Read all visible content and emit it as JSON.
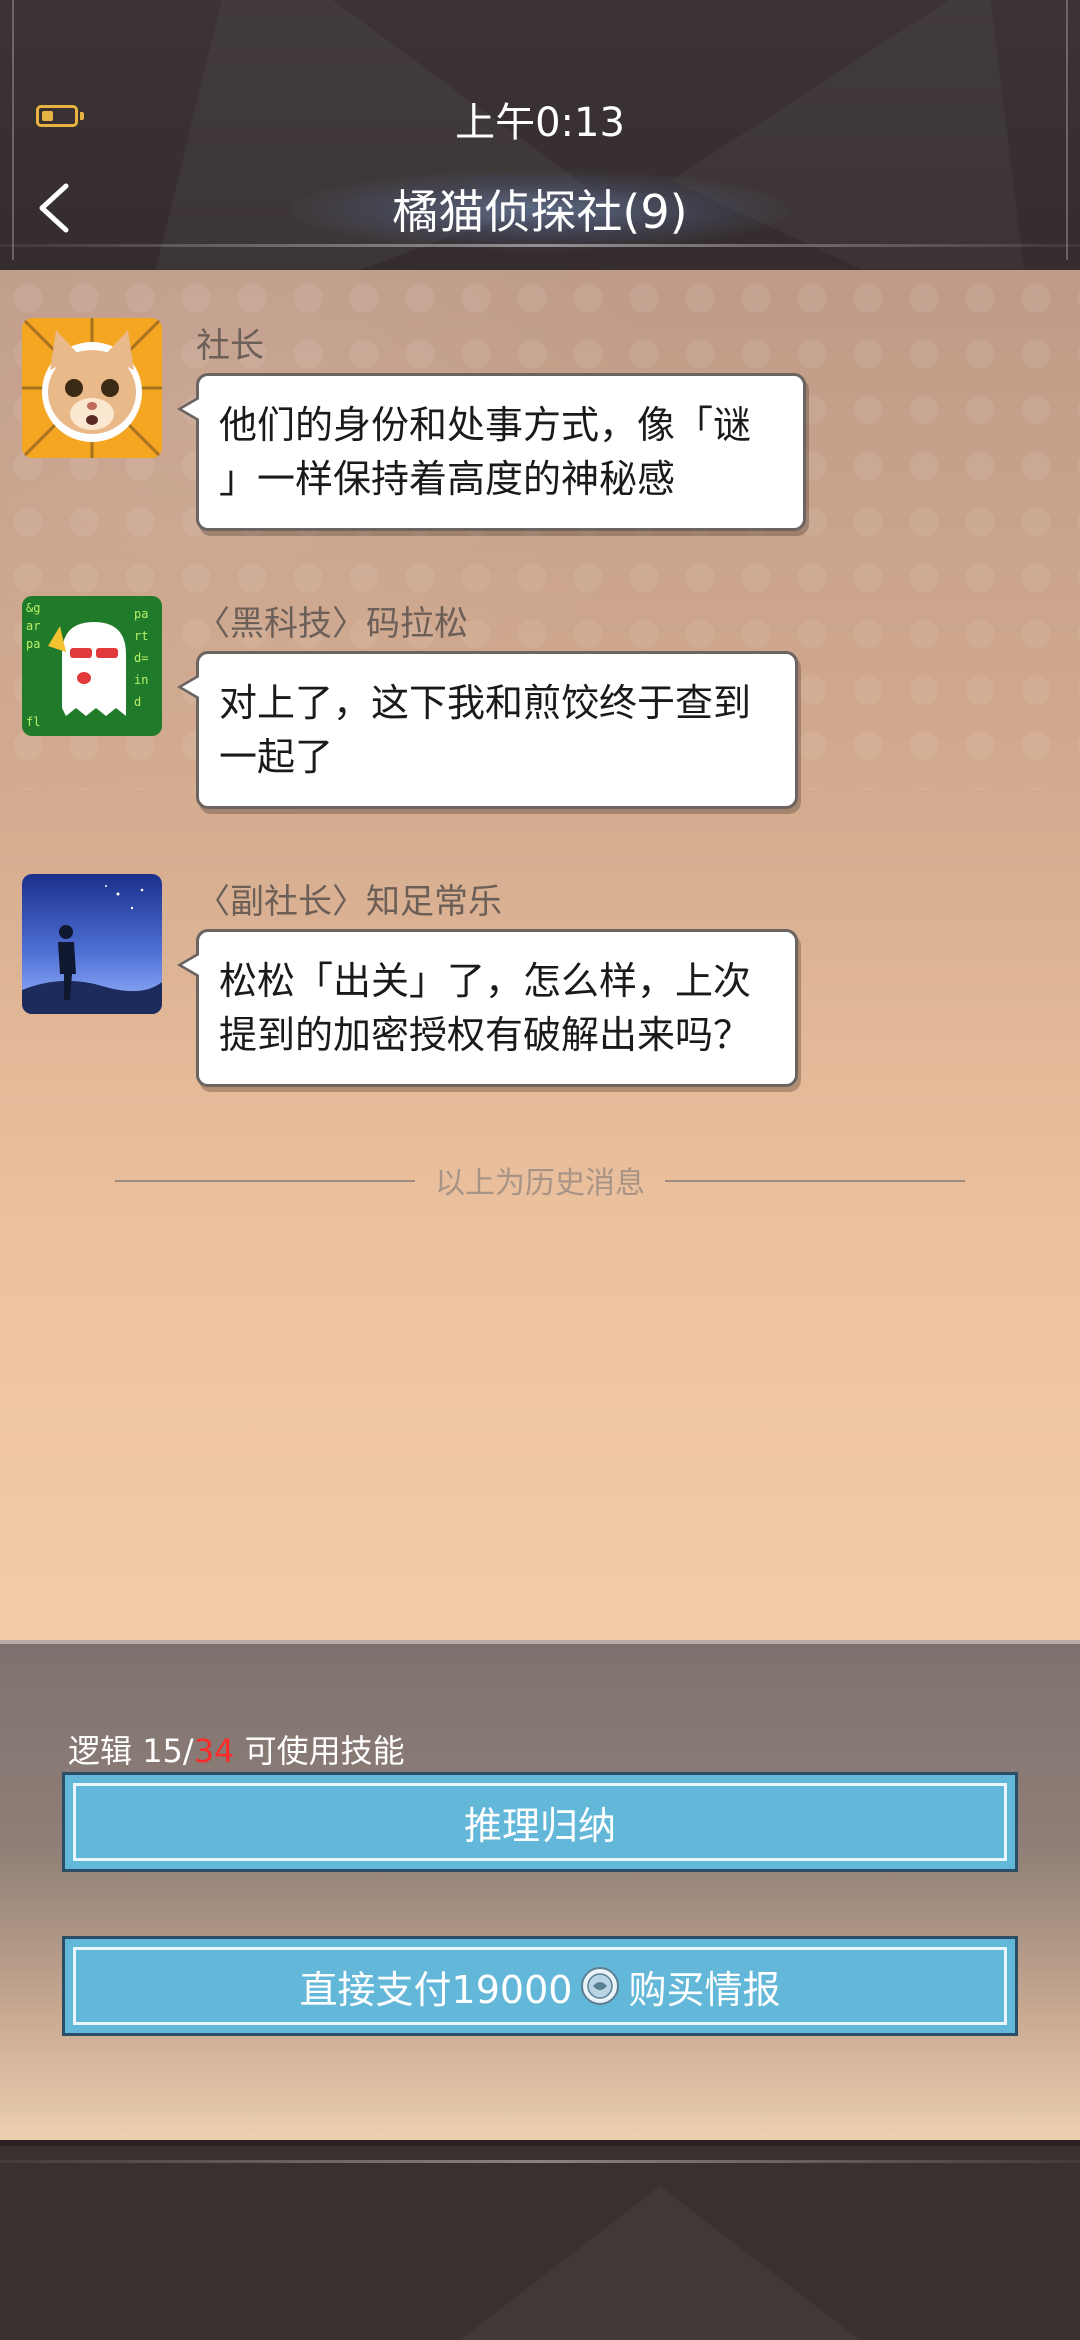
{
  "status_bar": {
    "time": "上午0:13",
    "battery_level": 0.35,
    "battery_color": "#e7b341"
  },
  "header": {
    "back_icon": "chevron-left-icon",
    "title": "橘猫侦探社(9)"
  },
  "messages": [
    {
      "sender": "社长",
      "avatar": "orange-cat-avatar",
      "lines": [
        "他们的身份和处事方式，像「谜",
        "」一样保持着高度的神秘感"
      ]
    },
    {
      "sender": "〈黑科技〉码拉松",
      "avatar": "code-ghost-avatar",
      "lines": [
        "对上了，这下我和煎饺终于查到",
        "一起了"
      ]
    },
    {
      "sender": "〈副社长〉知足常乐",
      "avatar": "night-sky-walker-avatar",
      "lines": [
        "松松「出关」了，怎么样，上次",
        "提到的加密授权有破解出来吗？"
      ]
    }
  ],
  "history_divider": "以上为历史消息",
  "skill_panel": {
    "logic_label": "逻辑",
    "logic_current": "15",
    "logic_separator": "/",
    "logic_max": "34",
    "logic_suffix": "可使用技能",
    "max_color": "#ff2a2a",
    "reason_button": "推理归纳",
    "buy_prefix": "直接支付19000",
    "buy_icon": "coin-icon",
    "buy_suffix": "购买情报"
  },
  "colors": {
    "button_fill": "#63b8da",
    "button_border": "#2b4d66",
    "header_bg": "#3c3434"
  }
}
